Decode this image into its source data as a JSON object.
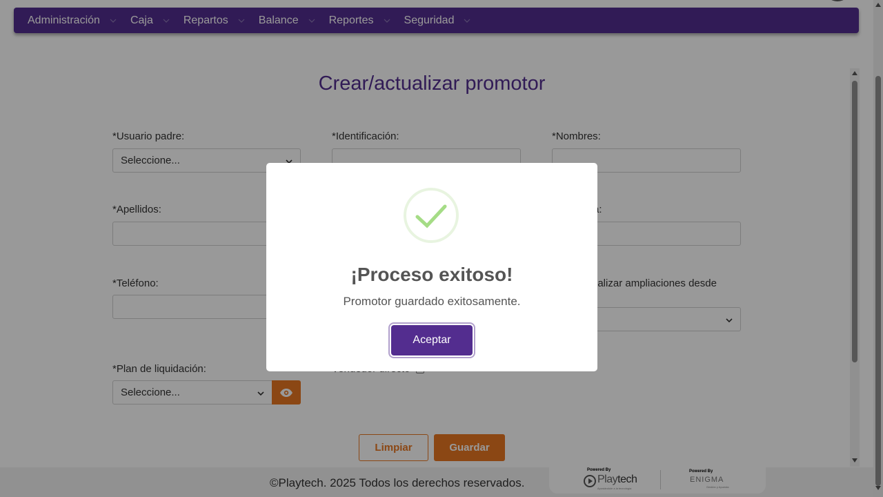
{
  "nav": {
    "items": [
      {
        "label": "Administración"
      },
      {
        "label": "Caja"
      },
      {
        "label": "Repartos"
      },
      {
        "label": "Balance"
      },
      {
        "label": "Reportes"
      },
      {
        "label": "Seguridad"
      }
    ]
  },
  "page": {
    "title": "Crear/actualizar promotor"
  },
  "form": {
    "usuario_padre_label": "*Usuario padre:",
    "usuario_padre_value": "Seleccione...",
    "identificacion_label": "*Identificación:",
    "nombres_label": "*Nombres:",
    "apellidos_label": "*Apellidos:",
    "col3_row2_label_partial": "a:",
    "telefono_label": "*Teléfono:",
    "ampliaciones_label_partial": "ealizar ampliaciones desde",
    "plan_label": "*Plan de liquidación:",
    "plan_value": "Seleccione...",
    "vendedor_directo_label_partial": "Vendedor directo"
  },
  "buttons": {
    "clear": "Limpiar",
    "save": "Guardar"
  },
  "footer": {
    "copyright": "©Playtech. 2025 Todos los derechos reservados.",
    "powered_by_1": "Powered By",
    "playtech_play": "Play",
    "playtech_tech": "tech",
    "playtech_sub": "Apostándole a la tecnología",
    "powered_by_2": "Powered By",
    "enigma": "ENIGMA",
    "enigma_sub": "Gestión y Apuesta"
  },
  "modal": {
    "title": "¡Proceso exitoso!",
    "message": "Promotor guardado exitosamente.",
    "accept": "Aceptar"
  },
  "colors": {
    "brand_purple": "#532d8f",
    "accent_orange": "#e87722",
    "success_green": "#a5dc86"
  },
  "icons": {
    "nav_chevron": "chevron-down-icon",
    "select_chevron": "chevron-down-icon",
    "eye": "eye-icon",
    "success": "success-check-icon"
  }
}
